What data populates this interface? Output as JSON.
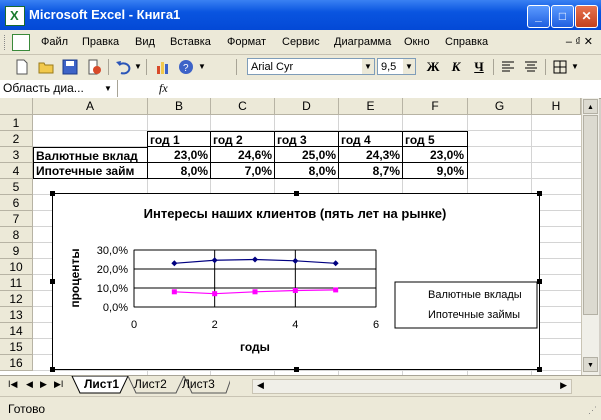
{
  "window": {
    "title": "Microsoft Excel - Книга1",
    "min": "_",
    "max": "□",
    "close": "✕"
  },
  "menu": {
    "items": [
      "Файл",
      "Правка",
      "Вид",
      "Вставка",
      "Формат",
      "Сервис",
      "Диаграмма",
      "Окно",
      "Справка"
    ],
    "doc_controls": "–  ₫  ✕"
  },
  "toolbar": {
    "font": "Arial Cyr",
    "size": "9,5",
    "bold": "Ж",
    "italic": "К",
    "underline": "Ч"
  },
  "formula": {
    "namebox": "Область диа...",
    "fx": "fx"
  },
  "columns": [
    "A",
    "B",
    "C",
    "D",
    "E",
    "F",
    "G",
    "H"
  ],
  "rows": [
    "1",
    "2",
    "3",
    "4",
    "5",
    "6",
    "7",
    "8",
    "9",
    "10",
    "11",
    "12",
    "13",
    "14",
    "15",
    "16"
  ],
  "table": {
    "headers": [
      "год 1",
      "год 2",
      "год 3",
      "год 4",
      "год 5"
    ],
    "rows": [
      {
        "label": "Валютные вклад",
        "values": [
          "23,0%",
          "24,6%",
          "25,0%",
          "24,3%",
          "23,0%"
        ]
      },
      {
        "label": "Ипотечные займ",
        "values": [
          "8,0%",
          "7,0%",
          "8,0%",
          "8,7%",
          "9,0%"
        ]
      }
    ]
  },
  "chart_data": {
    "type": "scatter",
    "title": "Интересы наших клиентов (пять лет на рынке)",
    "xlabel": "годы",
    "ylabel": "проценты",
    "xlim": [
      0,
      6
    ],
    "ylim": [
      0,
      30
    ],
    "xticks": [
      "0",
      "2",
      "4",
      "6"
    ],
    "yticks": [
      "0,0%",
      "10,0%",
      "20,0%",
      "30,0%"
    ],
    "grid": true,
    "legend": "right",
    "series": [
      {
        "name": "Валютные вклады",
        "color": "#000080",
        "marker": "diamond",
        "x": [
          1,
          2,
          3,
          4,
          5
        ],
        "values": [
          23.0,
          24.6,
          25.0,
          24.3,
          23.0
        ]
      },
      {
        "name": "Ипотечные займы",
        "color": "#ff00ff",
        "marker": "square",
        "x": [
          1,
          2,
          3,
          4,
          5
        ],
        "values": [
          8.0,
          7.0,
          8.0,
          8.7,
          9.0
        ]
      }
    ]
  },
  "sheets": {
    "tabs": [
      "Лист1",
      "Лист2",
      "Лист3"
    ],
    "active": "Лист1"
  },
  "status": {
    "text": "Готово"
  }
}
